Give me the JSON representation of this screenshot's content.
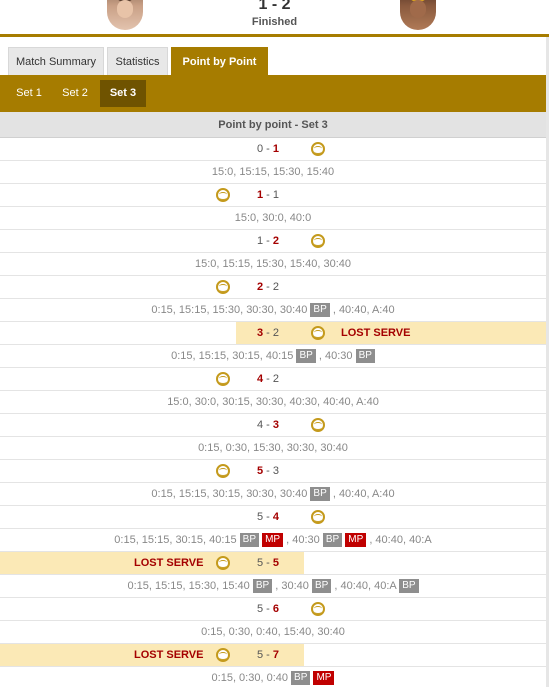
{
  "match": {
    "score": "1 - 2",
    "status": "Finished",
    "home_player_icon": "player-photo-icon",
    "away_player_icon": "player-photo-icon"
  },
  "tabs": [
    {
      "label": "Match Summary",
      "active": false
    },
    {
      "label": "Statistics",
      "active": false
    },
    {
      "label": "Point by Point",
      "active": true
    }
  ],
  "sets": [
    {
      "label": "Set 1",
      "active": false
    },
    {
      "label": "Set 2",
      "active": false
    },
    {
      "label": "Set 3",
      "active": true
    }
  ],
  "section_title": "Point by point - Set 3",
  "colors": {
    "accent": "#a67c00",
    "accent_dark": "#6f5300",
    "highlight": "#fbe9b6",
    "score_red": "#a40000",
    "mp_red": "#c00000",
    "badge_gray": "#8e8e8e"
  },
  "games": [
    {
      "home": "0",
      "away": "1",
      "winner": "away",
      "server": "away",
      "lost_serve": "",
      "points": [
        {
          "text": "15:0, 15:15, 15:30, 15:40"
        }
      ]
    },
    {
      "home": "1",
      "away": "1",
      "winner": "home",
      "server": "home",
      "lost_serve": "",
      "points": [
        {
          "text": "15:0, 30:0, 40:0"
        }
      ]
    },
    {
      "home": "1",
      "away": "2",
      "winner": "away",
      "server": "away",
      "lost_serve": "",
      "points": [
        {
          "text": "15:0, 15:15, 15:30, 15:40, 30:40"
        }
      ]
    },
    {
      "home": "2",
      "away": "2",
      "winner": "home",
      "server": "home",
      "lost_serve": "",
      "points": [
        {
          "text": "0:15, 15:15, 15:30, 30:30, 30:40"
        },
        {
          "badge": "BP"
        },
        {
          "text": ", 40:40, A:40"
        }
      ]
    },
    {
      "home": "3",
      "away": "2",
      "winner": "home",
      "server": "away",
      "lost_serve": "LOST SERVE",
      "points": [
        {
          "text": "0:15, 15:15, 30:15, 40:15"
        },
        {
          "badge": "BP"
        },
        {
          "text": ", 40:30"
        },
        {
          "badge": "BP"
        }
      ]
    },
    {
      "home": "4",
      "away": "2",
      "winner": "home",
      "server": "home",
      "lost_serve": "",
      "points": [
        {
          "text": "15:0, 30:0, 30:15, 30:30, 40:30, 40:40, A:40"
        }
      ]
    },
    {
      "home": "4",
      "away": "3",
      "winner": "away",
      "server": "away",
      "lost_serve": "",
      "points": [
        {
          "text": "0:15, 0:30, 15:30, 30:30, 30:40"
        }
      ]
    },
    {
      "home": "5",
      "away": "3",
      "winner": "home",
      "server": "home",
      "lost_serve": "",
      "points": [
        {
          "text": "0:15, 15:15, 30:15, 30:30, 30:40"
        },
        {
          "badge": "BP"
        },
        {
          "text": ", 40:40, A:40"
        }
      ]
    },
    {
      "home": "5",
      "away": "4",
      "winner": "away",
      "server": "away",
      "lost_serve": "",
      "points": [
        {
          "text": "0:15, 15:15, 30:15, 40:15"
        },
        {
          "badge": "BP"
        },
        {
          "badge": "MP"
        },
        {
          "text": ", 40:30"
        },
        {
          "badge": "BP"
        },
        {
          "badge": "MP"
        },
        {
          "text": ", 40:40, 40:A"
        }
      ]
    },
    {
      "home": "5",
      "away": "5",
      "winner": "away",
      "server": "home",
      "lost_serve": "LOST SERVE",
      "points": [
        {
          "text": "0:15, 15:15, 15:30, 15:40"
        },
        {
          "badge": "BP"
        },
        {
          "text": ", 30:40"
        },
        {
          "badge": "BP"
        },
        {
          "text": ", 40:40, 40:A"
        },
        {
          "badge": "BP"
        }
      ]
    },
    {
      "home": "5",
      "away": "6",
      "winner": "away",
      "server": "away",
      "lost_serve": "",
      "points": [
        {
          "text": "0:15, 0:30, 0:40, 15:40, 30:40"
        }
      ]
    },
    {
      "home": "5",
      "away": "7",
      "winner": "away",
      "server": "home",
      "lost_serve": "LOST SERVE",
      "points": [
        {
          "text": "0:15, 0:30, 0:40"
        },
        {
          "badge": "BP"
        },
        {
          "badge": "MP"
        }
      ]
    }
  ]
}
